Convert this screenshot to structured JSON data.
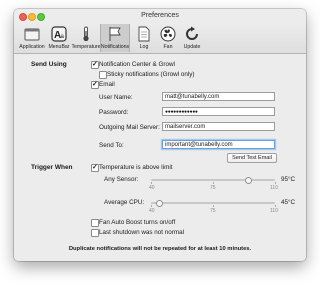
{
  "window": {
    "title": "Preferences"
  },
  "toolbar": {
    "items": [
      {
        "label": "Application",
        "icon": "window-icon"
      },
      {
        "label": "MenuBar",
        "icon": "font-a-icon"
      },
      {
        "label": "Temperature",
        "icon": "thermometer-icon"
      },
      {
        "label": "Notifications",
        "icon": "flag-icon",
        "selected": true
      },
      {
        "label": "Log",
        "icon": "log-document-icon"
      },
      {
        "label": "Fan",
        "icon": "fan-icon"
      },
      {
        "label": "Update",
        "icon": "refresh-icon"
      }
    ]
  },
  "send_using": {
    "heading": "Send Using",
    "notification_center": {
      "label": "Notification Center & Growl",
      "checked": true
    },
    "sticky": {
      "label": "Sticky notifications (Growl only)",
      "checked": false
    },
    "email": {
      "label": "Email",
      "checked": true
    },
    "user_name": {
      "label": "User Name:",
      "value": "matt@tunabelly.com"
    },
    "password": {
      "label": "Password:",
      "value": "●●●●●●●●●●●●"
    },
    "mail_server": {
      "label": "Outgoing Mail Server:",
      "value": "mailserver.com"
    },
    "send_to": {
      "label": "Send To:",
      "value": "important@tunabelly.com"
    },
    "send_test_button": "Send Test Email"
  },
  "trigger_when": {
    "heading": "Trigger When",
    "temp_above": {
      "label": "Temperature is above limit",
      "checked": true
    },
    "any_sensor": {
      "label": "Any Sensor:",
      "value_text": "95°C",
      "fraction": 0.786,
      "min": "40",
      "mid": "75",
      "max": "110"
    },
    "average_cpu": {
      "label": "Average CPU:",
      "value_text": "45°C",
      "fraction": 0.07,
      "min": "40",
      "mid": "75",
      "max": "110"
    },
    "fan_boost": {
      "label": "Fan Auto Boost turns on/off",
      "checked": false
    },
    "last_shutdown": {
      "label": "Last shutdown was not normal",
      "checked": false
    }
  },
  "footer_note": "Duplicate notifications will not be repeated for at least 10 minutes.",
  "colors": {
    "accent": "#6b9ee0",
    "close": "#ee5f56",
    "minimize": "#f6bc30",
    "zoom": "#5fc73e"
  }
}
